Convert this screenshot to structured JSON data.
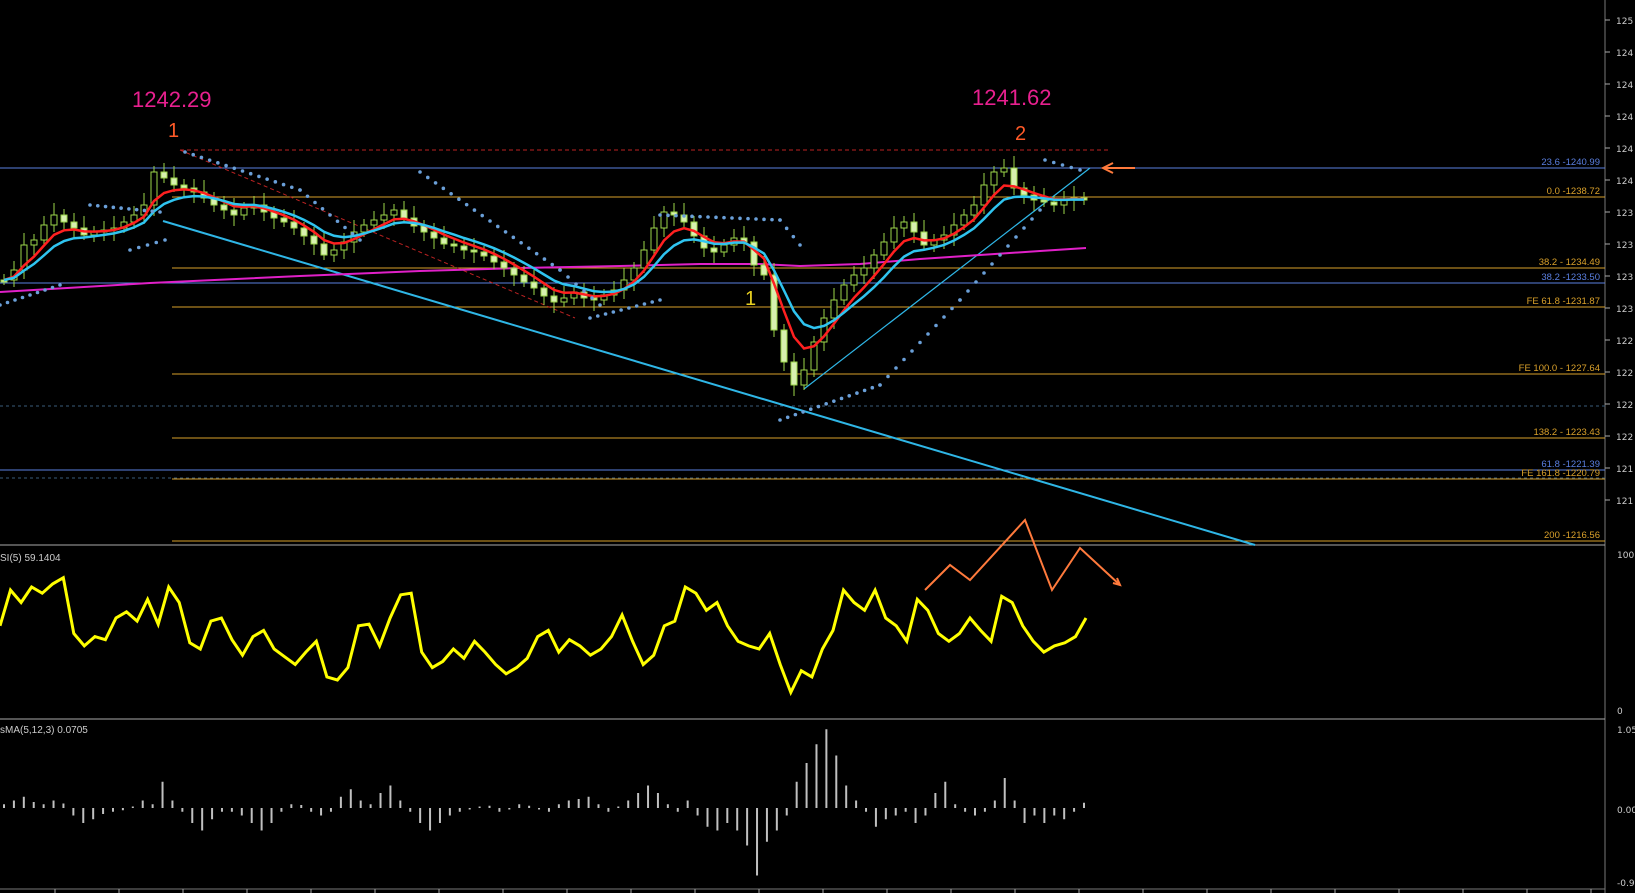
{
  "chart_data": {
    "type": "candlestick",
    "price_axis": {
      "tick_labels": [
        "125",
        "124",
        "124",
        "124",
        "124",
        "124",
        "123",
        "123",
        "123",
        "123",
        "122",
        "122",
        "122",
        "122",
        "121",
        "121"
      ]
    },
    "peaks": [
      {
        "price": "1242.29",
        "wave": "1"
      },
      {
        "price": "1241.62",
        "wave": "2"
      }
    ],
    "trough_wave_label": "1",
    "fib_levels": [
      {
        "label": "23.6 -1240.99",
        "color": "#5a7fe0"
      },
      {
        "label": "0.0 -1238.72",
        "color": "#d9a02a"
      },
      {
        "label": "38.2 - 1234.49",
        "color": "#d9a02a"
      },
      {
        "label": "38.2 -1233.50",
        "color": "#5a7fe0"
      },
      {
        "label": "FE 61.8 -1231.87",
        "color": "#d9a02a"
      },
      {
        "label": "FE 100.0 - 1227.64",
        "color": "#d9a02a"
      },
      {
        "label": "138.2 - 1223.43",
        "color": "#d9a02a"
      },
      {
        "label": "61.8 -1221.39",
        "color": "#5a7fe0"
      },
      {
        "label": "FE 161.8 -1220.79",
        "color": "#d9a02a"
      },
      {
        "label": "200 -1216.56",
        "color": "#d9a02a"
      }
    ],
    "rsi": {
      "label": "SI(5) 59.1404",
      "scale_top": "100",
      "scale_bottom": "0",
      "values": [
        55,
        78,
        70,
        80,
        76,
        82,
        86,
        50,
        42,
        48,
        46,
        60,
        64,
        58,
        72,
        56,
        80,
        70,
        44,
        40,
        58,
        60,
        46,
        36,
        48,
        52,
        40,
        35,
        30,
        38,
        45,
        22,
        20,
        28,
        55,
        56,
        42,
        60,
        75,
        76,
        38,
        28,
        32,
        40,
        34,
        45,
        38,
        30,
        24,
        28,
        34,
        48,
        52,
        38,
        46,
        42,
        36,
        40,
        48,
        62,
        45,
        30,
        36,
        55,
        58,
        80,
        76,
        65,
        70,
        55,
        45,
        42,
        40,
        50,
        30,
        12,
        26,
        22,
        40,
        52,
        78,
        70,
        65,
        78,
        60,
        55,
        45,
        72,
        65,
        50,
        45,
        50,
        60,
        52,
        45,
        74,
        70,
        55,
        45,
        38,
        42,
        44,
        48,
        60
      ],
      "color": "#ffff00"
    },
    "osma": {
      "label": "sMA(5,12,3) 0.0705",
      "scale_top": "1.05",
      "scale_mid": "0.00",
      "scale_bottom": "-0.9",
      "values": [
        0.05,
        0.1,
        0.15,
        0.08,
        0.05,
        0.1,
        0.06,
        -0.1,
        -0.2,
        -0.15,
        -0.08,
        -0.05,
        -0.03,
        0.02,
        0.1,
        0.05,
        0.35,
        0.1,
        -0.05,
        -0.2,
        -0.3,
        -0.15,
        -0.05,
        -0.05,
        -0.1,
        -0.2,
        -0.3,
        -0.2,
        -0.05,
        0.05,
        0.04,
        -0.05,
        -0.1,
        -0.05,
        0.15,
        0.25,
        0.1,
        0.05,
        0.2,
        0.3,
        0.1,
        -0.05,
        -0.2,
        -0.3,
        -0.2,
        -0.1,
        -0.05,
        -0.02,
        0.02,
        0.03,
        -0.05,
        -0.02,
        0.05,
        0.03,
        -0.02,
        -0.05,
        0.05,
        0.1,
        0.12,
        0.15,
        0.05,
        -0.05,
        0.02,
        0.1,
        0.2,
        0.3,
        0.2,
        0.05,
        -0.05,
        0.1,
        -0.1,
        -0.25,
        -0.3,
        -0.2,
        -0.3,
        -0.5,
        -0.9,
        -0.45,
        -0.3,
        -0.1,
        0.35,
        0.6,
        0.85,
        1.05,
        0.7,
        0.3,
        0.1,
        -0.05,
        -0.25,
        -0.15,
        -0.1,
        -0.05,
        -0.2,
        -0.1,
        0.2,
        0.35,
        0.05,
        -0.05,
        -0.1,
        -0.05,
        0.1,
        0.4,
        0.1,
        -0.2,
        -0.1,
        -0.2,
        -0.1,
        -0.15,
        -0.05,
        0.07
      ],
      "color": "#c0c0c0"
    }
  }
}
